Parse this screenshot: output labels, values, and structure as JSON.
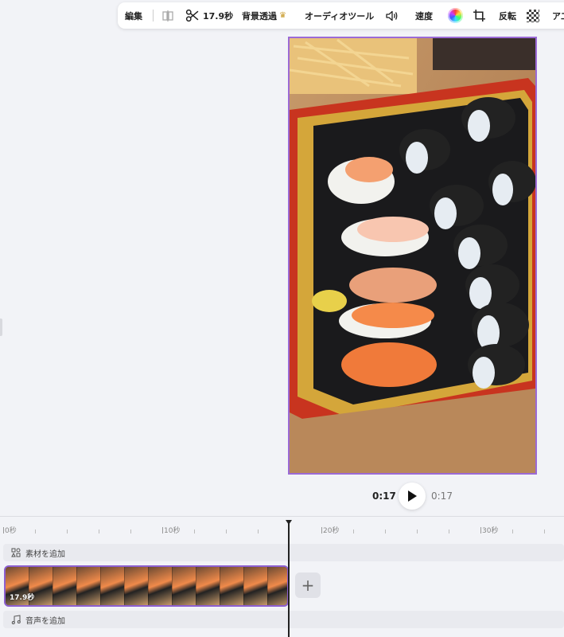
{
  "toolbar": {
    "edit_label": "編集",
    "duration_label": "17.9秒",
    "background_remove_label": "背景透過",
    "audio_tools_label": "オーディオツール",
    "speed_label": "速度",
    "flip_label": "反転",
    "overflow_label": "ア二"
  },
  "player": {
    "current_time": "0:17",
    "total_time": "0:17"
  },
  "timeline": {
    "ruler": [
      "0秒",
      "10秒",
      "20秒",
      "30秒"
    ],
    "add_media_label": "素材を追加",
    "clip_duration": "17.9秒",
    "add_audio_label": "音声を追加"
  },
  "colors": {
    "accent": "#8c5fd0",
    "background": "#f2f3f7"
  },
  "icons": [
    "split-icon",
    "scissors-icon",
    "crown-icon",
    "speaker-icon",
    "color-wheel-icon",
    "crop-icon",
    "transparency-icon",
    "play-icon",
    "add-media-icon",
    "music-note-icon",
    "plus-icon"
  ]
}
